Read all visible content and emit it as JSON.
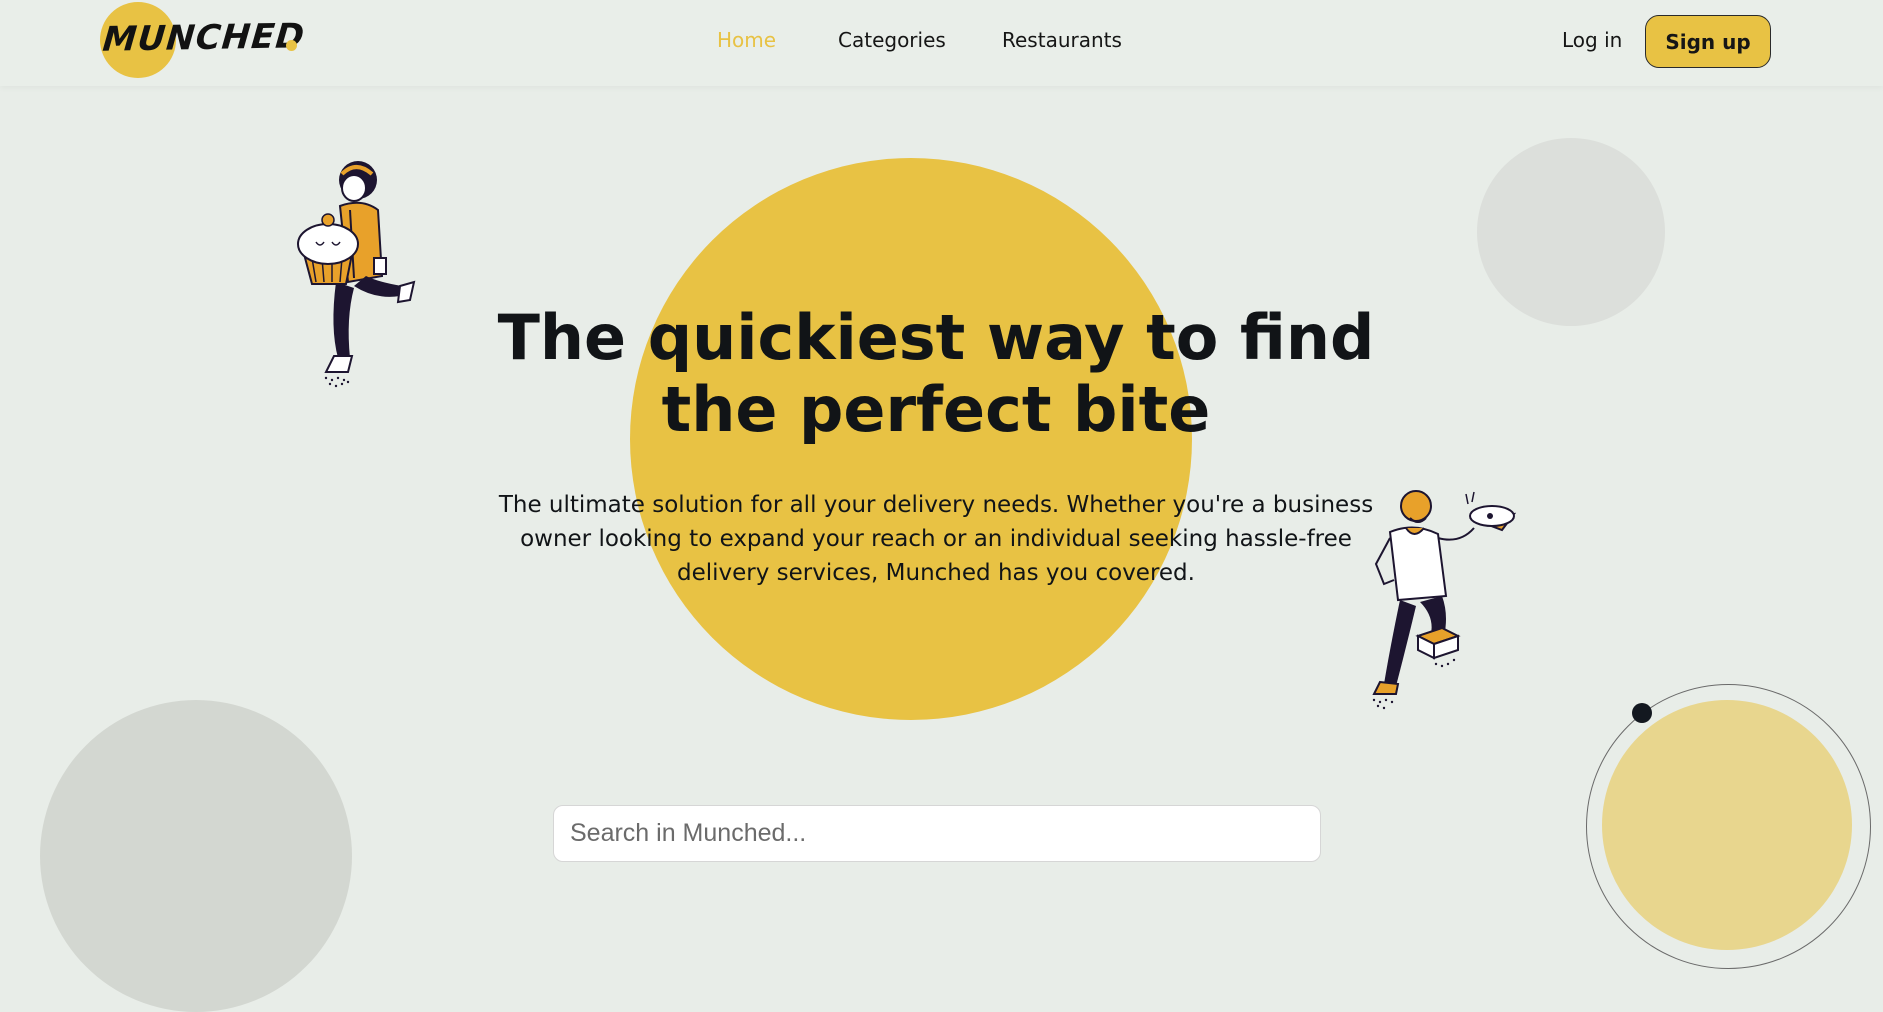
{
  "brand": {
    "logo_text": "MUNCHED",
    "accent_color": "#e8c244"
  },
  "nav": {
    "items": [
      "Home",
      "Categories",
      "Restaurants"
    ],
    "active": "Home"
  },
  "auth": {
    "login_label": "Log in",
    "signup_label": "Sign up"
  },
  "hero": {
    "title": "The quickiest way to find the perfect bite",
    "subtitle": "The ultimate solution for all your delivery needs. Whether you're a business owner looking to expand your reach or an individual seeking hassle-free delivery services, Munched has you covered."
  },
  "search": {
    "placeholder": "Search in Munched...",
    "value": ""
  },
  "icons": {
    "left_illustration": "person-carrying-cupcake-icon",
    "right_illustration": "chef-holding-pizza-icon"
  },
  "colors": {
    "background": "#e8ede8",
    "accent": "#e8c244",
    "accent_light": "#e8d68e",
    "text": "#111417"
  }
}
